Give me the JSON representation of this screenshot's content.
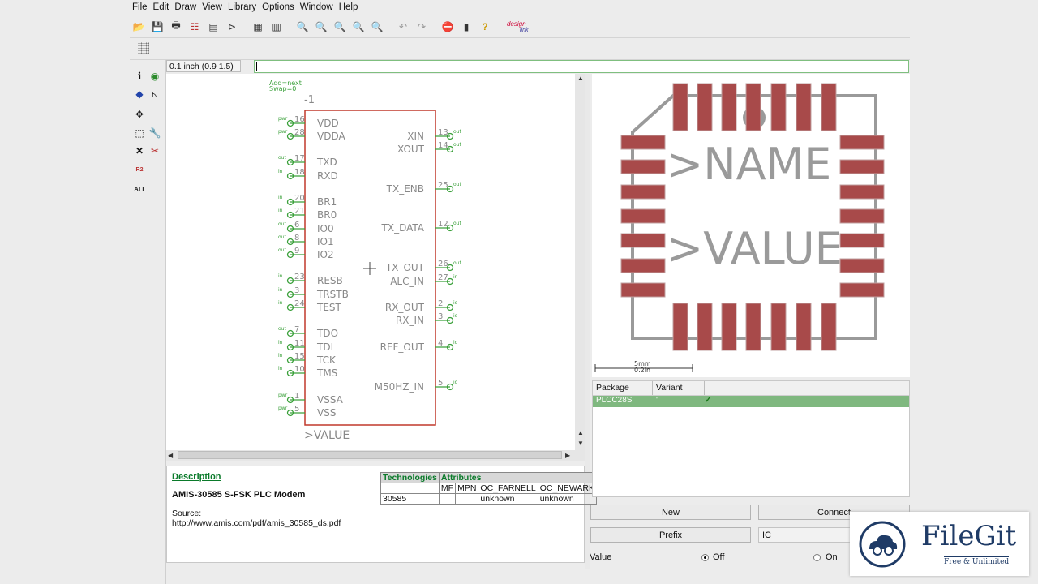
{
  "menu": [
    {
      "label": "File",
      "u": "F",
      "rest": "ile"
    },
    {
      "label": "Edit",
      "u": "E",
      "rest": "dit"
    },
    {
      "label": "Draw",
      "u": "D",
      "rest": "raw"
    },
    {
      "label": "View",
      "u": "V",
      "rest": "iew"
    },
    {
      "label": "Library",
      "u": "L",
      "rest": "ibrary"
    },
    {
      "label": "Options",
      "u": "O",
      "rest": "ptions"
    },
    {
      "label": "Window",
      "u": "W",
      "rest": "indow"
    },
    {
      "label": "Help",
      "u": "H",
      "rest": "elp"
    }
  ],
  "toolbar": {
    "icons": [
      "open-icon",
      "save-icon",
      "print-icon",
      "cam-icon",
      "script-icon",
      "run-icon",
      "grid-icon",
      "layers-icon",
      "zoom-fit-icon",
      "zoom-in-icon",
      "zoom-out-icon",
      "zoom-select-icon",
      "zoom-redraw-icon",
      "undo-icon",
      "redo-icon",
      "stop-icon",
      "go-icon",
      "help-icon"
    ],
    "logo_top": "design",
    "logo_bottom": "link"
  },
  "coords": "0.1 inch (0.9 1.5)",
  "command_line": "",
  "symbol": {
    "add_note": "Add=next",
    "swap_note": "Swap=0",
    "name_label": "-1",
    "value_label": ">VALUE",
    "left_pins": [
      {
        "name": "VDD",
        "num": "16",
        "dir": "pwr"
      },
      {
        "name": "VDDA",
        "num": "28",
        "dir": "pwr"
      },
      {
        "name": "TXD",
        "num": "17",
        "dir": "out"
      },
      {
        "name": "RXD",
        "num": "18",
        "dir": "in"
      },
      {
        "name": "BR1",
        "num": "20",
        "dir": "in"
      },
      {
        "name": "BR0",
        "num": "21",
        "dir": "in"
      },
      {
        "name": "IO0",
        "num": "6",
        "dir": "out"
      },
      {
        "name": "IO1",
        "num": "8",
        "dir": "out"
      },
      {
        "name": "IO2",
        "num": "9",
        "dir": "out"
      },
      {
        "name": "RESB",
        "num": "23",
        "dir": "in"
      },
      {
        "name": "TRSTB",
        "num": "3",
        "dir": "in"
      },
      {
        "name": "TEST",
        "num": "24",
        "dir": "in"
      },
      {
        "name": "TDO",
        "num": "7",
        "dir": "out"
      },
      {
        "name": "TDI",
        "num": "11",
        "dir": "in"
      },
      {
        "name": "TCK",
        "num": "15",
        "dir": "in"
      },
      {
        "name": "TMS",
        "num": "10",
        "dir": "in"
      },
      {
        "name": "VSSA",
        "num": "1",
        "dir": "pwr"
      },
      {
        "name": "VSS",
        "num": "5",
        "dir": "pwr"
      }
    ],
    "right_pins": [
      {
        "name": "XIN",
        "num": "13",
        "dir": "out"
      },
      {
        "name": "XOUT",
        "num": "14",
        "dir": "out"
      },
      {
        "name": "TX_ENB",
        "num": "25",
        "dir": "out"
      },
      {
        "name": "TX_DATA",
        "num": "12",
        "dir": "out"
      },
      {
        "name": "TX_OUT",
        "num": "26",
        "dir": "out"
      },
      {
        "name": "ALC_IN",
        "num": "27",
        "dir": "in"
      },
      {
        "name": "RX_OUT",
        "num": "2",
        "dir": "io"
      },
      {
        "name": "RX_IN",
        "num": "3",
        "dir": "io"
      },
      {
        "name": "REF_OUT",
        "num": "4",
        "dir": "io"
      },
      {
        "name": "M50HZ_IN",
        "num": "5",
        "dir": "io"
      }
    ]
  },
  "package_view": {
    "name_text": ">NAME",
    "value_text": ">VALUE",
    "scale_mm": "5mm",
    "scale_in": "0.2in"
  },
  "description": {
    "title": "Description",
    "part": "AMIS-30585 S-FSK PLC Modem",
    "source_label": "Source:",
    "source_url": "http://www.amis.com/pdf/amis_30585_ds.pdf"
  },
  "tech_table": {
    "head1": "Technologies",
    "head2": "Attributes",
    "cols": [
      "MF",
      "MPN",
      "OC_FARNELL",
      "OC_NEWARK"
    ],
    "row": [
      "30585",
      "",
      "",
      "unknown",
      "unknown"
    ]
  },
  "packages": {
    "col_package": "Package",
    "col_variant": "Variant",
    "rows": [
      {
        "package": "PLCC28S",
        "variant": "'",
        "check": "✓"
      }
    ]
  },
  "buttons": {
    "new": "New",
    "connect": "Connect",
    "prefix": "Prefix",
    "prefix_value": "IC",
    "value_label": "Value",
    "off": "Off",
    "on": "On"
  },
  "watermark": {
    "brand": "FileGit",
    "tagline": "Free & Unlimited"
  },
  "colors": {
    "pin_green": "#3aa03a",
    "symbol_red": "#c0392b",
    "pad_red": "#a84a4a",
    "outline_gray": "#9a9a9a",
    "selection_green": "#7fb87f"
  }
}
